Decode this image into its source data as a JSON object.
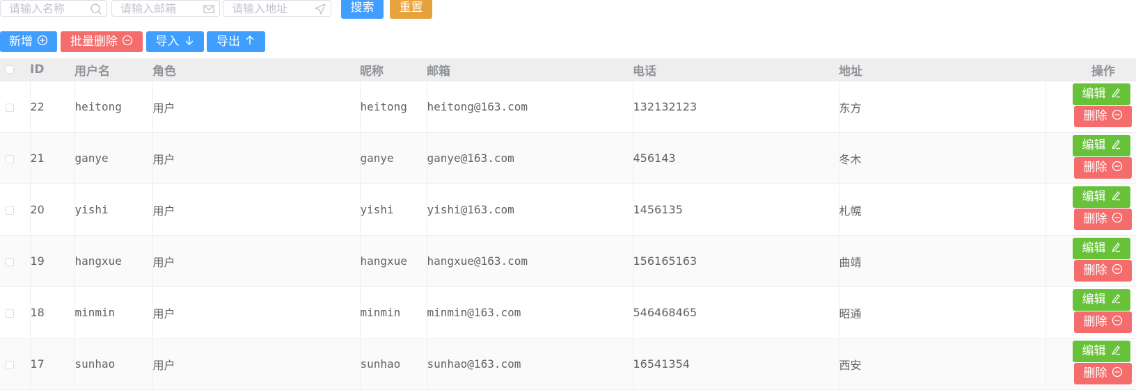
{
  "search": {
    "name_placeholder": "请输入名称",
    "email_placeholder": "请输入邮箱",
    "address_placeholder": "请输入地址",
    "search_label": "搜索",
    "reset_label": "重置"
  },
  "toolbar": {
    "add_label": "新增",
    "batch_delete_label": "批量删除",
    "import_label": "导入",
    "export_label": "导出"
  },
  "table": {
    "headers": {
      "id": "ID",
      "username": "用户名",
      "role": "角色",
      "nickname": "昵称",
      "email": "邮箱",
      "phone": "电话",
      "address": "地址",
      "actions": "操作"
    },
    "edit_label": "编辑",
    "delete_label": "删除",
    "rows": [
      {
        "id": "22",
        "username": "heitong",
        "role": "用户",
        "nickname": "heitong",
        "email": "heitong@163.com",
        "phone": "132132123",
        "address": "东方"
      },
      {
        "id": "21",
        "username": "ganye",
        "role": "用户",
        "nickname": "ganye",
        "email": "ganye@163.com",
        "phone": "456143",
        "address": "冬木"
      },
      {
        "id": "20",
        "username": "yishi",
        "role": "用户",
        "nickname": "yishi",
        "email": "yishi@163.com",
        "phone": "1456135",
        "address": "札幌"
      },
      {
        "id": "19",
        "username": "hangxue",
        "role": "用户",
        "nickname": "hangxue",
        "email": "hangxue@163.com",
        "phone": "156165163",
        "address": "曲靖"
      },
      {
        "id": "18",
        "username": "minmin",
        "role": "用户",
        "nickname": "minmin",
        "email": "minmin@163.com",
        "phone": "546468465",
        "address": "昭通"
      },
      {
        "id": "17",
        "username": "sunhao",
        "role": "用户",
        "nickname": "sunhao",
        "email": "sunhao@163.com",
        "phone": "16541354",
        "address": "西安"
      }
    ]
  },
  "icons": {
    "name_input": "search-icon",
    "email_input": "mail-icon",
    "address_input": "location-arrow-icon",
    "add": "circle-plus-icon",
    "batch_delete": "circle-minus-icon",
    "import": "arrow-down-icon",
    "export": "arrow-up-icon",
    "edit": "pencil-icon",
    "delete": "circle-minus-icon"
  },
  "colors": {
    "primary": "#409eff",
    "warning": "#e6a23c",
    "danger": "#f56c6c",
    "success": "#67c23a"
  }
}
